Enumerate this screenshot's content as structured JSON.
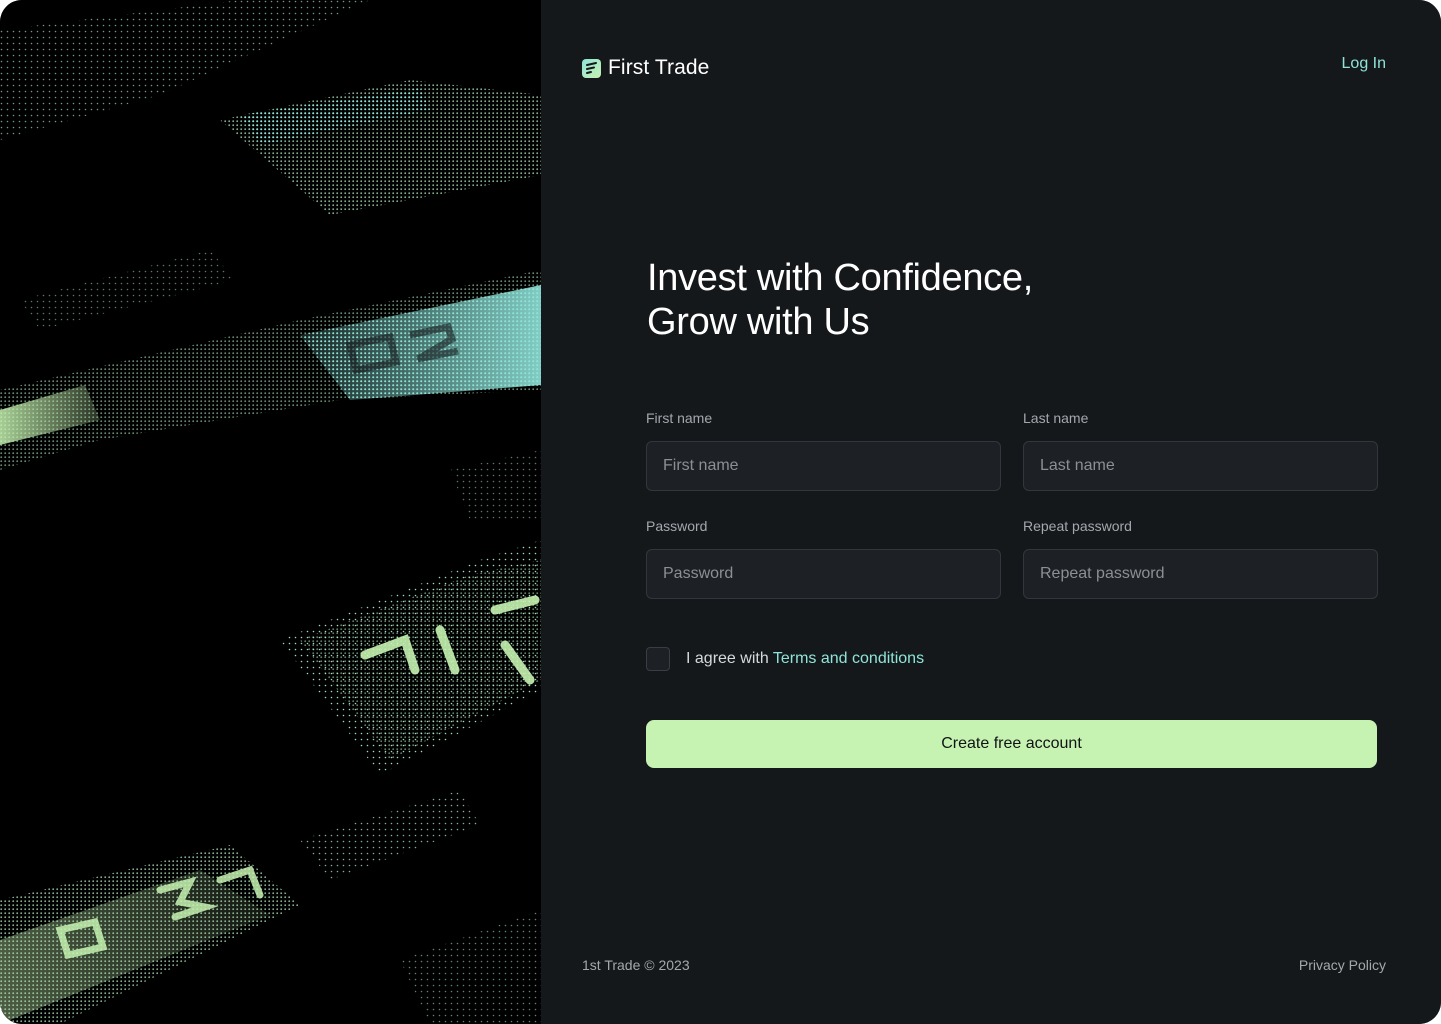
{
  "brand": {
    "name": "First Trade",
    "accent": "#8fe3d9",
    "cta_color": "#c6f3b1",
    "background": "#15181b"
  },
  "header": {
    "login_label": "Log In"
  },
  "hero": {
    "line1": "Invest with Confidence,",
    "line2": "Grow with Us"
  },
  "form": {
    "first_name": {
      "label": "First name",
      "placeholder": "First name",
      "value": ""
    },
    "last_name": {
      "label": "Last name",
      "placeholder": "Last name",
      "value": ""
    },
    "password": {
      "label": "Password",
      "placeholder": "Password",
      "value": ""
    },
    "repeat_password": {
      "label": "Repeat password",
      "placeholder": "Repeat password",
      "value": ""
    },
    "agree": {
      "prefix": "I agree with ",
      "link_label": "Terms and conditions",
      "checked": false
    },
    "submit_label": "Create free account"
  },
  "footer": {
    "copyright": "1st Trade © 2023",
    "privacy_label": "Privacy Policy"
  },
  "art": {
    "description_icon": "dotted-ticker-artwork",
    "colors": [
      "#8fe3d9",
      "#c6f3b1"
    ]
  }
}
